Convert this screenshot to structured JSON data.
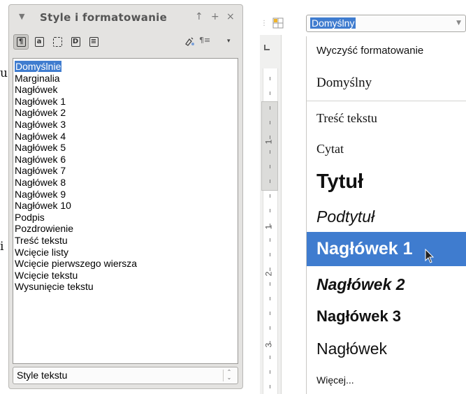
{
  "edge": {
    "char1": "u",
    "char2": "i"
  },
  "panel": {
    "title": "Style i formatowanie",
    "title_buttons": [
      "↑",
      "+",
      "×"
    ],
    "toolbar_glyphs": [
      "¶",
      "a",
      "",
      "D",
      "≡"
    ],
    "toolbar_right": [
      "¶≡",
      "▾"
    ]
  },
  "styles_list": [
    "Domyślnie",
    "Marginalia",
    "Nagłówek",
    "Nagłówek 1",
    "Nagłówek 2",
    "Nagłówek 3",
    "Nagłówek 4",
    "Nagłówek 5",
    "Nagłówek 6",
    "Nagłówek 7",
    "Nagłówek 8",
    "Nagłówek 9",
    "Nagłówek 10",
    "Podpis",
    "Pozdrowienie",
    "Treść tekstu",
    "Wcięcie listy",
    "Wcięcie pierwszego wiersza",
    "Wcięcie tekstu",
    "Wysunięcie tekstu"
  ],
  "filter": {
    "value": "Style tekstu"
  },
  "combo": {
    "value": "Domyślny"
  },
  "ruler": {
    "numbers": [
      "1",
      "1",
      "2",
      "3"
    ]
  },
  "dropdown": {
    "clear": "Wyczyść formatowanie",
    "default": "Domyślny",
    "body_text": "Treść tekstu",
    "quote": "Cytat",
    "title": "Tytuł",
    "subtitle": "Podtytuł",
    "heading1": "Nagłówek 1",
    "heading2": "Nagłówek 2",
    "heading3": "Nagłówek 3",
    "heading": "Nagłówek",
    "more": "Więcej..."
  },
  "colors": {
    "selection": "#3f7ccf",
    "panel_bg": "#e4e3e1"
  }
}
